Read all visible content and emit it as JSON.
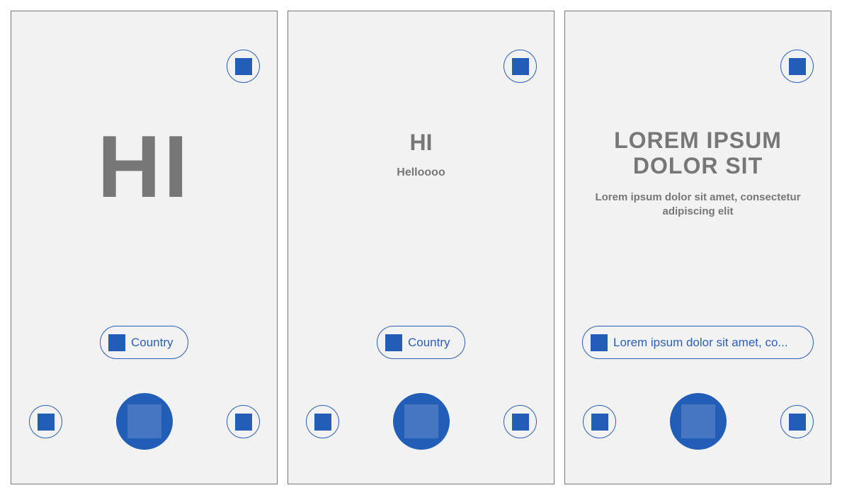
{
  "colors": {
    "accent": "#225db8",
    "text": "#777777",
    "background": "#f2f2f2"
  },
  "screens": [
    {
      "title": "HI",
      "subtitle": "",
      "chip_label": "Country"
    },
    {
      "title": "HI",
      "subtitle": "Helloooo",
      "chip_label": "Country"
    },
    {
      "title_line1": "LOREM IPSUM",
      "title_line2": "DOLOR SIT",
      "subtitle_line1": "Lorem ipsum dolor sit amet, consectetur",
      "subtitle_line2": "adipiscing elit",
      "chip_label": "Lorem ipsum dolor sit amet, co..."
    }
  ]
}
